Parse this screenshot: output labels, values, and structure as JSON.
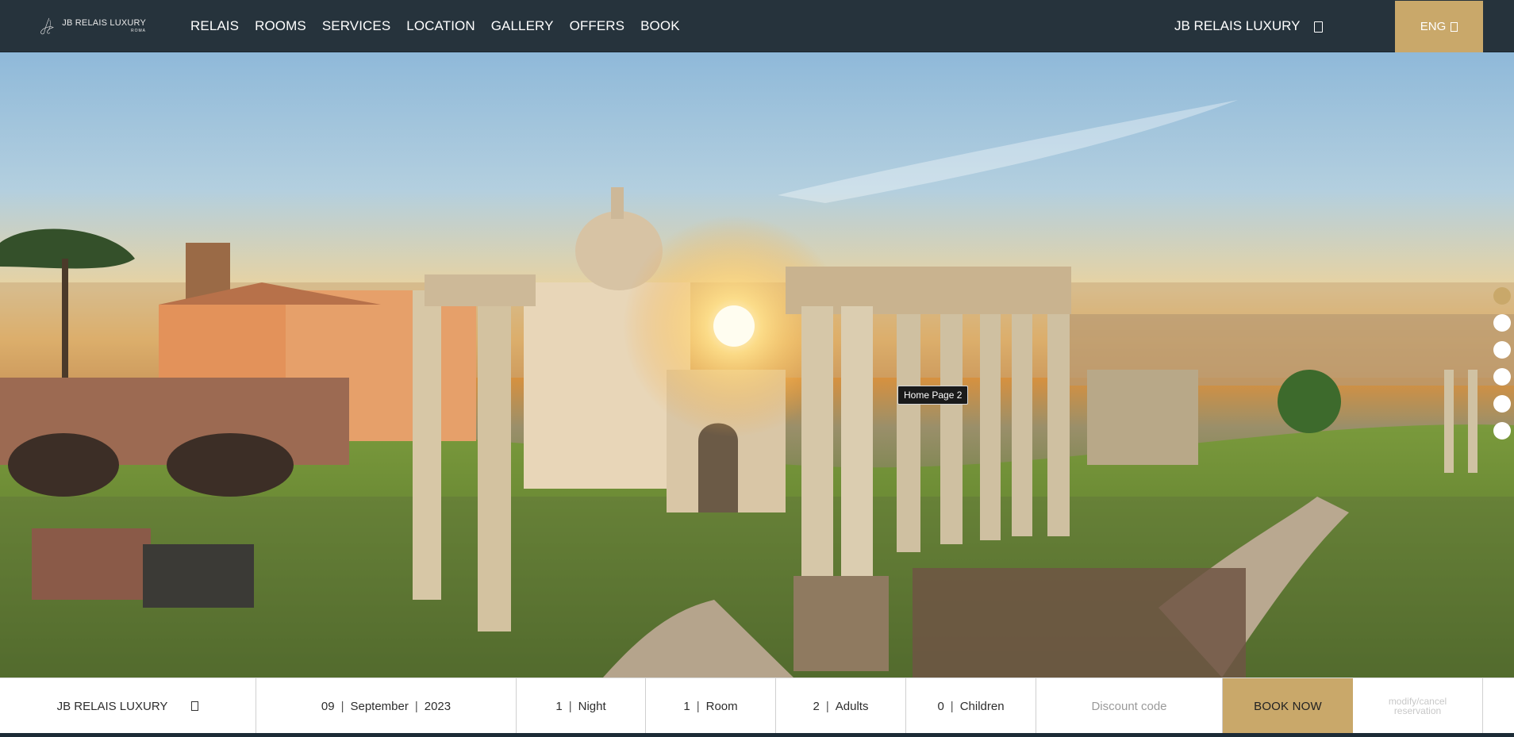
{
  "header": {
    "logo_text": "JB RELAIS LUXURY",
    "logo_sub": "ROMA",
    "nav": [
      "RELAIS",
      "ROOMS",
      "SERVICES",
      "LOCATION",
      "GALLERY",
      "OFFERS",
      "BOOK"
    ],
    "brand_right": "JB RELAIS LUXURY",
    "brand_icon": "square-icon",
    "language": "ENG"
  },
  "hero": {
    "tooltip": "Home Page 2",
    "slides_count": 6,
    "active_slide": 1
  },
  "booking": {
    "hotel": "JB RELAIS LUXURY",
    "day": "09",
    "month": "September",
    "year": "2023",
    "nights_value": "1",
    "nights_label": "Night",
    "rooms_value": "1",
    "rooms_label": "Room",
    "adults_value": "2",
    "adults_label": "Adults",
    "children_value": "0",
    "children_label": "Children",
    "discount_placeholder": "Discount code",
    "book_label": "BOOK NOW",
    "modify_label": "modify/cancel reservation",
    "separator": "|"
  },
  "colors": {
    "header_bg": "#26333c",
    "accent_gold": "#c9a86a",
    "white": "#ffffff"
  }
}
